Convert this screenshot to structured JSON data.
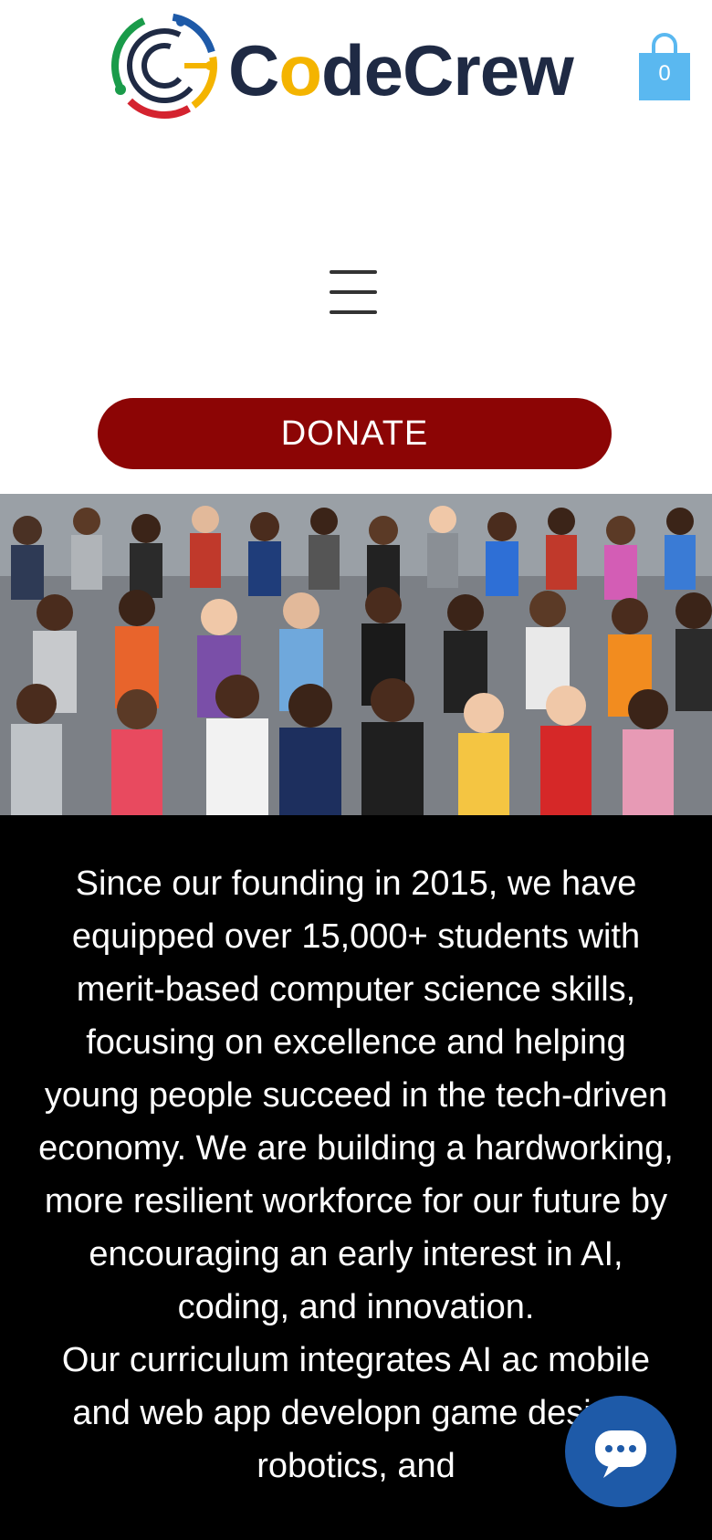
{
  "header": {
    "logo_text": [
      "C",
      "o",
      "deCrew"
    ],
    "logo_colors": [
      "#1f2a44",
      "#f4b400",
      "#1a9b4a",
      "#d4232f",
      "#1e5aa8"
    ],
    "cart": {
      "icon": "shopping-bag-icon",
      "count": "0",
      "color": "#5ab8f0"
    },
    "menu": {
      "icon": "hamburger-menu-icon"
    },
    "donate_label": "DONATE",
    "donate_color": "#8c0505"
  },
  "hero": {
    "photo_icon": "group-photo-image"
  },
  "mission": {
    "paragraph_1": "Since our founding in 2015, we have equipped over 15,000+ students with merit-based computer science skills, focusing on excellence and helping young people succeed in the tech-driven economy. We are building a hardworking, more resilient workforce for our future by encouraging an early interest in AI, coding, and innovation.",
    "paragraph_2": "Our curriculum integrates AI ac mobile and web app developn game design, robotics, and"
  },
  "chat": {
    "icon": "chat-bubble-icon",
    "color": "#1e5aa8"
  }
}
